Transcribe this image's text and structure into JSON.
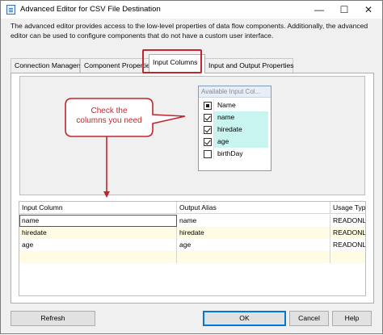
{
  "window": {
    "title": "Advanced Editor for CSV File  Destination",
    "minimize_glyph": "—",
    "maximize_glyph": "☐",
    "close_glyph": "✕"
  },
  "description": "The advanced editor provides access to the low-level properties of data flow components. Additionally, the advanced editor can be used to configure components that do not have a custom user interface.",
  "tabs": [
    {
      "label": "Connection Managers",
      "active": false
    },
    {
      "label": "Component Properties",
      "active": false
    },
    {
      "label": "Input Columns",
      "active": true
    },
    {
      "label": "Input and Output Properties",
      "active": false
    }
  ],
  "available_columns": {
    "title": "Available Input Col...",
    "header_label": "Name",
    "items": [
      {
        "name": "name",
        "checked": true
      },
      {
        "name": "hiredate",
        "checked": true
      },
      {
        "name": "age",
        "checked": true
      },
      {
        "name": "birthDay",
        "checked": false
      }
    ]
  },
  "callout": {
    "line1": "Check the",
    "line2": "columns you need",
    "color": "#c0272d"
  },
  "grid": {
    "headers": [
      "Input Column",
      "Output Alias",
      "Usage Type"
    ],
    "rows": [
      [
        "name",
        "name",
        "READONLY"
      ],
      [
        "hiredate",
        "hiredate",
        "READONLY"
      ],
      [
        "age",
        "age",
        "READONLY"
      ]
    ]
  },
  "buttons": {
    "refresh": "Refresh",
    "ok": "OK",
    "cancel": "Cancel",
    "help": "Help"
  }
}
